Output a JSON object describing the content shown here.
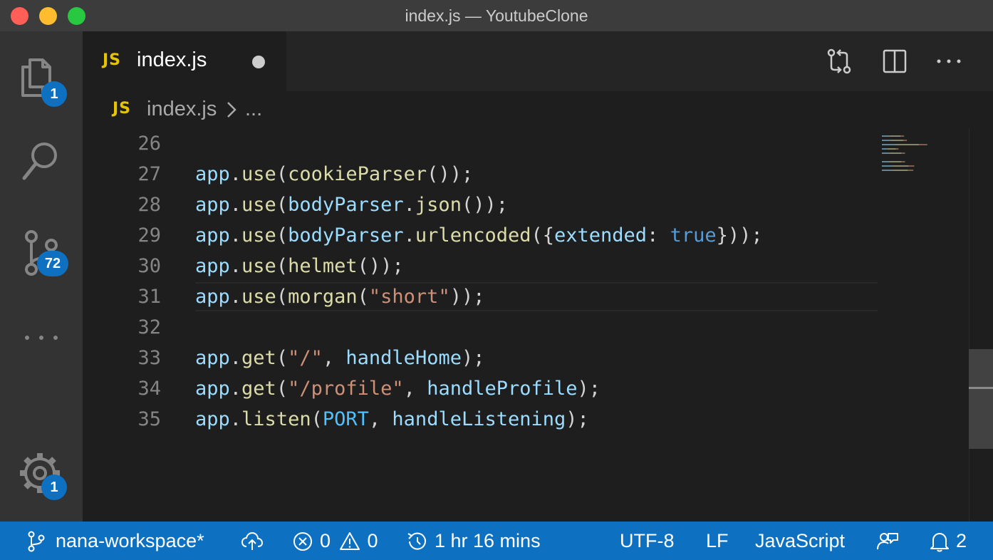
{
  "window": {
    "title": "index.js — YoutubeClone"
  },
  "activity_bar": {
    "explorer_badge": "1",
    "source_control_badge": "72",
    "settings_badge": "1"
  },
  "tabs": [
    {
      "icon_text": "JS",
      "label": "index.js",
      "dirty": true
    }
  ],
  "breadcrumb": {
    "icon_text": "JS",
    "file": "index.js",
    "more": "..."
  },
  "editor": {
    "language": "javascript",
    "current_line": 31,
    "lines": [
      {
        "number": "26",
        "text": ""
      },
      {
        "number": "27",
        "text": "app.use(cookieParser());"
      },
      {
        "number": "28",
        "text": "app.use(bodyParser.json());"
      },
      {
        "number": "29",
        "text": "app.use(bodyParser.urlencoded({extended: true}));"
      },
      {
        "number": "30",
        "text": "app.use(helmet());"
      },
      {
        "number": "31",
        "text": "app.use(morgan(\"short\"));"
      },
      {
        "number": "32",
        "text": ""
      },
      {
        "number": "33",
        "text": "app.get(\"/\", handleHome);"
      },
      {
        "number": "34",
        "text": "app.get(\"/profile\", handleProfile);"
      },
      {
        "number": "35",
        "text": "app.listen(PORT, handleListening);"
      }
    ]
  },
  "status_bar": {
    "branch": "nana-workspace*",
    "errors": "0",
    "warnings": "0",
    "time_tracked": "1 hr 16 mins",
    "encoding": "UTF-8",
    "line_ending": "LF",
    "language_mode": "JavaScript",
    "notifications": "2"
  },
  "colors": {
    "status_bar": "#0e70c0",
    "activity_bar": "#333333",
    "editor_bg": "#1e1e1e",
    "js_icon": "#e5c400",
    "badge": "#0e70c0"
  },
  "icons": [
    "files-icon",
    "search-icon",
    "source-control-icon",
    "more-icon",
    "gear-icon",
    "compare-changes-icon",
    "split-editor-icon",
    "more-actions-icon",
    "branch-icon",
    "sync-icon",
    "error-icon",
    "warning-icon",
    "history-icon",
    "feedback-icon",
    "bell-icon"
  ]
}
